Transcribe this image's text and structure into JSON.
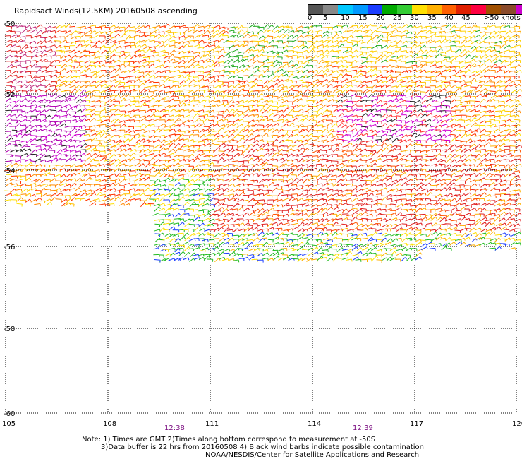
{
  "title": "Rapidsact Winds(12.5KM) 20160508 ascending",
  "legend": {
    "colors": [
      "#555555",
      "#888888",
      "#00c8ff",
      "#0099ff",
      "#1a3cff",
      "#00aa00",
      "#33cc33",
      "#ffe000",
      "#ffb000",
      "#ff6000",
      "#e02000",
      "#ff0040",
      "#a05000",
      "#8a4a2a",
      "#cc00cc",
      "#8000b0"
    ],
    "labels": [
      "0",
      "5",
      "10",
      "15",
      "20",
      "25",
      "30",
      "35",
      "40",
      "45",
      ">50 knots"
    ]
  },
  "axes": {
    "x_ticks": [
      "105",
      "108",
      "111",
      "114",
      "117",
      "120"
    ],
    "y_ticks": [
      "-50",
      "-52",
      "-54",
      "-56",
      "-58",
      "-60"
    ]
  },
  "times": [
    "12:38",
    "12:39"
  ],
  "notes": [
    "Note: 1) Times are GMT 2)Times along bottom correspond to measurement at -50S",
    "3)Data buffer is 22 hrs from 20160508 4) Black wind barbs indicate possible contamination",
    "NOAA/NESDIS/Center for Satellite Applications and Research"
  ]
}
